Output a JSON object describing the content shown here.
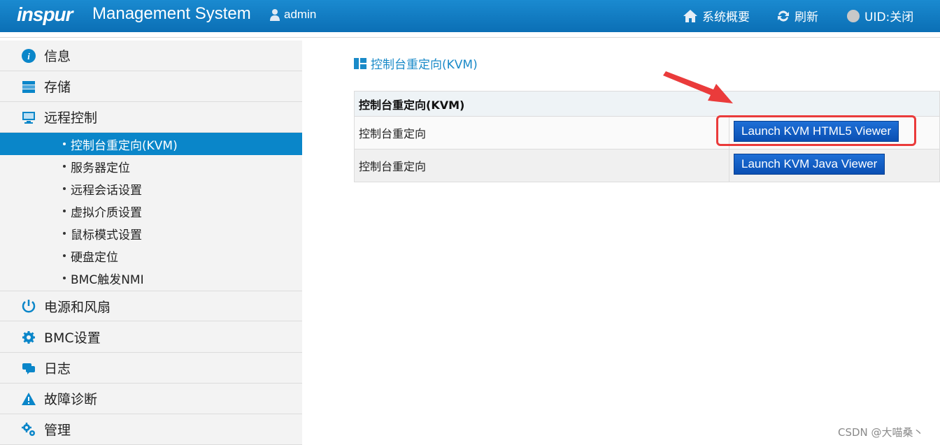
{
  "header": {
    "logo": "inspur",
    "title": "Management System",
    "user": "admin",
    "nav": [
      {
        "label": "系统概要",
        "icon": "home-icon"
      },
      {
        "label": "刷新",
        "icon": "refresh-icon"
      },
      {
        "label": "UID:关闭",
        "icon": "uid-status-icon"
      }
    ]
  },
  "sidebar": {
    "items": [
      {
        "label": "信息",
        "icon": "info-icon"
      },
      {
        "label": "存储",
        "icon": "storage-icon"
      },
      {
        "label": "远程控制",
        "icon": "monitor-icon"
      },
      {
        "label": "电源和风扇",
        "icon": "power-icon"
      },
      {
        "label": "BMC设置",
        "icon": "gear-icon"
      },
      {
        "label": "日志",
        "icon": "chat-icon"
      },
      {
        "label": "故障诊断",
        "icon": "warning-icon"
      },
      {
        "label": "管理",
        "icon": "manage-gear-icon"
      }
    ],
    "sub_items": [
      {
        "label": "控制台重定向(KVM)",
        "active": true
      },
      {
        "label": "服务器定位"
      },
      {
        "label": "远程会话设置"
      },
      {
        "label": "虚拟介质设置"
      },
      {
        "label": "鼠标模式设置"
      },
      {
        "label": "硬盘定位"
      },
      {
        "label": "BMC触发NMI"
      }
    ]
  },
  "main": {
    "page_title": "控制台重定向(KVM)",
    "table": {
      "header": "控制台重定向(KVM)",
      "rows": [
        {
          "label": "控制台重定向",
          "button": "Launch KVM HTML5 Viewer"
        },
        {
          "label": "控制台重定向",
          "button": "Launch KVM Java Viewer"
        }
      ]
    }
  },
  "colors": {
    "accent": "#0a86c9",
    "highlight": "#ea3b3b"
  },
  "watermark": "CSDN @大喵桑丶"
}
